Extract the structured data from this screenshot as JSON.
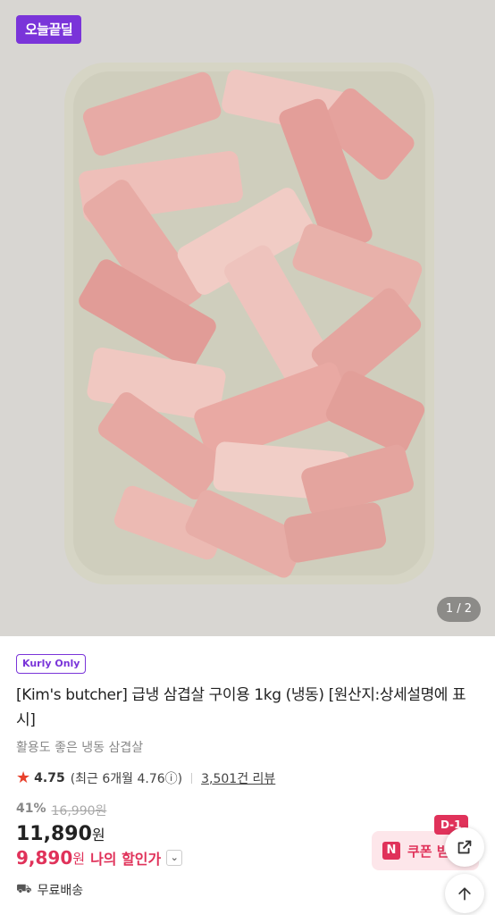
{
  "hero": {
    "badge": "오늘끝딜",
    "counter": "1 / 2",
    "image_alt": "pork belly slices on plate"
  },
  "product": {
    "tag": "Kurly Only",
    "title": "[Kim's butcher] 급냉 삼겹살 구이용 1kg (냉동) [원산지:상세설명에 표시]",
    "subtitle": "활용도 좋은 냉동 삼겹살",
    "rating": "4.75",
    "recent_rating": "(최근 6개월 4.76ⓘ)",
    "reviews": "3,501건 리뷰",
    "discount_pct": "41%",
    "original_price": "16,990원",
    "price": "11,890",
    "price_unit": "원",
    "my_price": "9,890",
    "my_price_unit": "원",
    "my_price_label": "나의 할인가",
    "shipping": "무료배송"
  },
  "coupon": {
    "dday": "D-1",
    "icon": "N",
    "label": "쿠폰 받"
  },
  "icons": {
    "share": "share-icon",
    "scroll_top": "arrow-up-icon",
    "star": "star-icon",
    "truck": "truck-icon",
    "chevron": "chevron-down-icon"
  },
  "colors": {
    "brand_purple": "#7a34d9",
    "price_red": "#e0325a",
    "star_red": "#e8412c"
  }
}
